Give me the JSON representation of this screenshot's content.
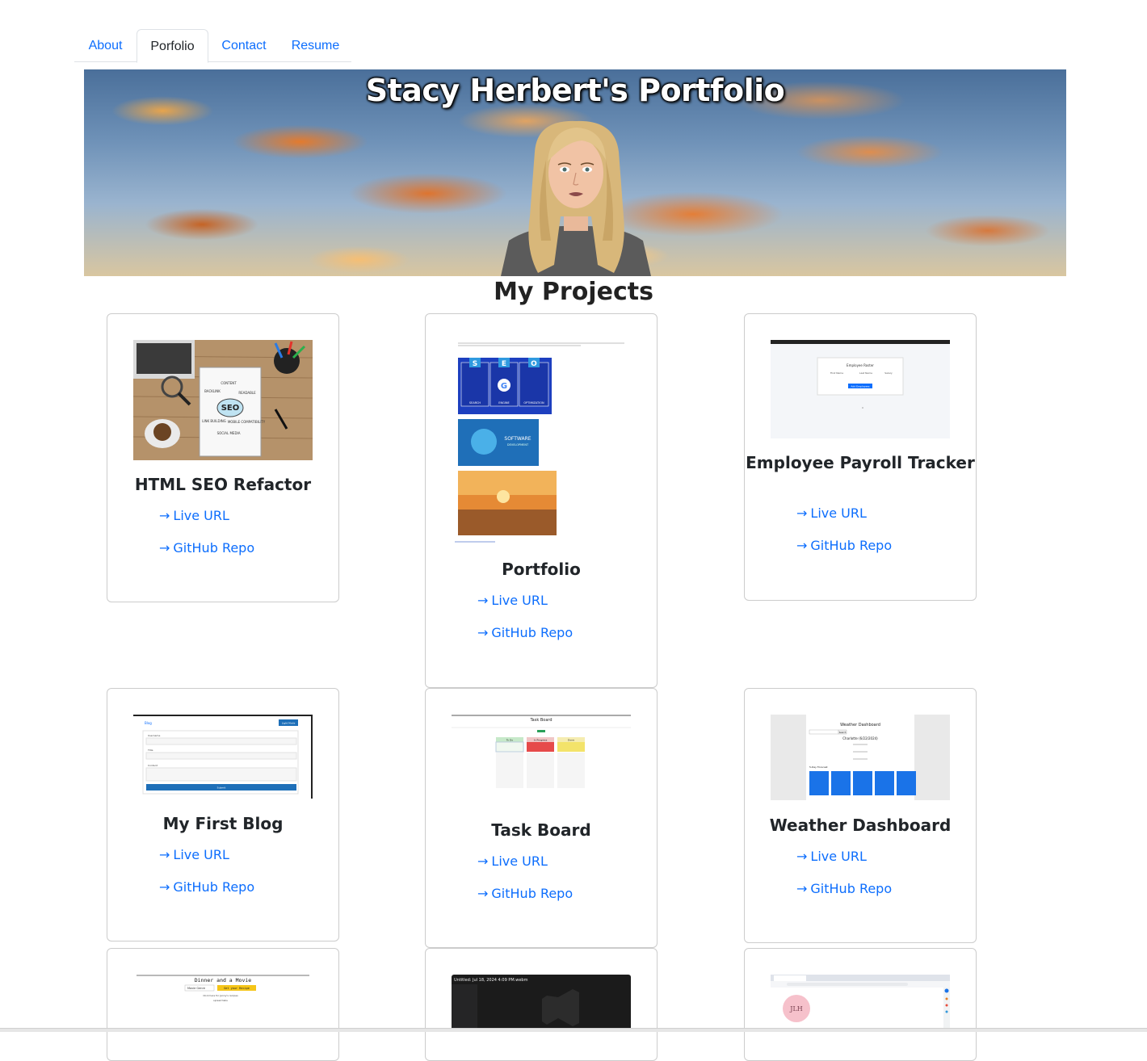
{
  "nav": {
    "tabs": [
      {
        "label": "About",
        "active": false
      },
      {
        "label": "Porfolio",
        "active": true
      },
      {
        "label": "Contact",
        "active": false
      },
      {
        "label": "Resume",
        "active": false
      }
    ]
  },
  "hero": {
    "title": "Stacy Herbert's Portfolio"
  },
  "main": {
    "heading": "My Projects",
    "projects": [
      {
        "title": "HTML SEO Refactor",
        "live_label": "Live URL",
        "repo_label": "GitHub Repo",
        "thumb_words": [
          "CONTENT",
          "BACKLINK",
          "READABLE",
          "SEO",
          "LINK BUILDING",
          "MOBILE COMPATIBILITY",
          "SOCIAL MEDIA"
        ]
      },
      {
        "title": "Portfolio",
        "live_label": "Live URL",
        "repo_label": "GitHub Repo",
        "thumb_words": [
          "S",
          "E",
          "O",
          "SEARCH",
          "ENGINE",
          "OPTIMIZATION",
          "SOFTWARE",
          "DEVELOPMENT"
        ]
      },
      {
        "title": "Employee Payroll Tracker",
        "live_label": "Live URL",
        "repo_label": "GitHub Repo",
        "thumb_words": [
          "Employee Roster",
          "First Name",
          "Last Name",
          "Salary",
          "Add Employees"
        ]
      },
      {
        "title": "My First Blog",
        "live_label": "Live URL",
        "repo_label": "GitHub Repo",
        "thumb_words": [
          "Blog",
          "Light Mode",
          "Username",
          "Title",
          "Content",
          "Submit"
        ]
      },
      {
        "title": "Task Board",
        "live_label": "Live URL",
        "repo_label": "GitHub Repo",
        "thumb_words": [
          "Task Board",
          "To Do",
          "In Progress",
          "Done"
        ]
      },
      {
        "title": "Weather Dashboard",
        "live_label": "Live URL",
        "repo_label": "GitHub Repo",
        "thumb_words": [
          "Weather Dashboard",
          "Search",
          "Charlotte (6/22/2024)",
          "5-Day Forecast"
        ]
      },
      {
        "title": "",
        "thumb_words": [
          "Dinner and a Movie",
          "Movie Genre",
          "Get your Recipe",
          "Click here for Jenny's recipes",
          "spread tabs"
        ]
      },
      {
        "title": "",
        "thumb_words": [
          "Untitled: Jul 18, 2024 4:09 PM.webm"
        ]
      },
      {
        "title": "",
        "thumb_words": [
          "JLH"
        ]
      }
    ]
  },
  "colors": {
    "link": "#0d6efd",
    "card_border": "#cccccc",
    "text": "#212529"
  }
}
